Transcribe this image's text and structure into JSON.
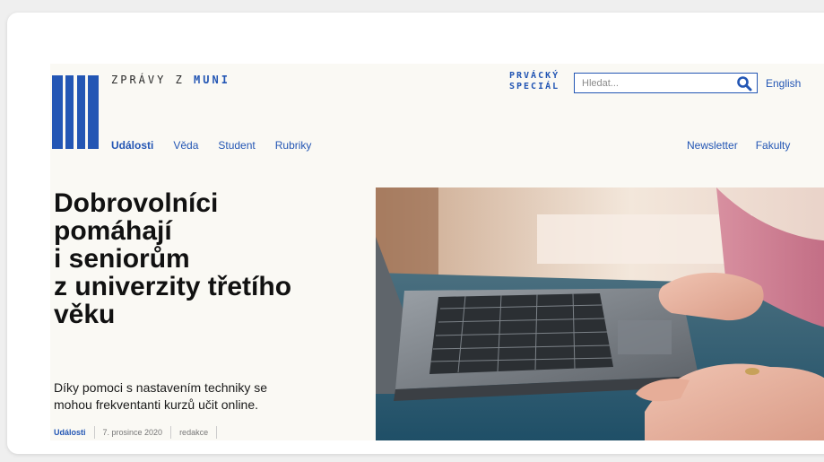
{
  "header": {
    "site_title_prefix": "ZPRÁVY Z ",
    "site_title_brand": "MUNI",
    "special_line1": "PRVÁCKÝ",
    "special_line2": "SPECIÁL",
    "search_placeholder": "Hledat...",
    "language": "English"
  },
  "nav": {
    "left": [
      {
        "label": "Události"
      },
      {
        "label": "Věda"
      },
      {
        "label": "Student"
      },
      {
        "label": "Rubriky"
      }
    ],
    "right": [
      {
        "label": "Newsletter"
      },
      {
        "label": "Fakulty"
      }
    ]
  },
  "article": {
    "headline": [
      "Dobrovolníci",
      "pomáhají",
      "i seniorům",
      "z univerzity třetího",
      "věku"
    ],
    "subhead_lines": [
      "Díky pomoci s nastavením techniky se",
      "mohou frekventanti kurzů učit online."
    ],
    "category": "Události",
    "date": "7. prosince 2020",
    "author": "redakce"
  },
  "colors": {
    "brand_blue": "#2356b4",
    "page_bg": "#faf9f4"
  },
  "icons": {
    "logo": "muni-m-logo",
    "search": "search-icon"
  }
}
